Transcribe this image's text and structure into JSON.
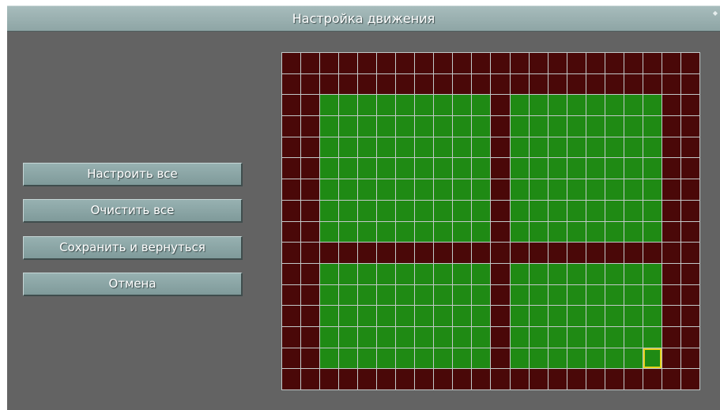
{
  "window": {
    "title": "Настройка движения",
    "corner_icon": "diamond-icon"
  },
  "buttons": {
    "setup_all": "Настроить все",
    "clear_all": "Очистить все",
    "save_return": "Сохранить и вернуться",
    "cancel": "Отмена"
  },
  "motion_grid": {
    "columns": 22,
    "rows": 16,
    "cursor": {
      "row": 14,
      "col": 19
    },
    "colors": {
      "active": "#1f8a14",
      "inactive": "#4a0808",
      "cursor": "#e5d21b",
      "grid_line": "#c2c8c8"
    },
    "cells": [
      "0000000000000000000000",
      "0000000000000000000000",
      "0011111111101111111100",
      "0011111111101111111100",
      "0011111111101111111100",
      "0011111111101111111100",
      "0011111111101111111100",
      "0011111111101111111100",
      "0011111111101111111100",
      "0000000000000000000000",
      "0011111111101111111100",
      "0011111111101111111100",
      "0011111111101111111100",
      "0011111111101111111100",
      "0011111111101111111100",
      "0000000000000000000000"
    ]
  }
}
